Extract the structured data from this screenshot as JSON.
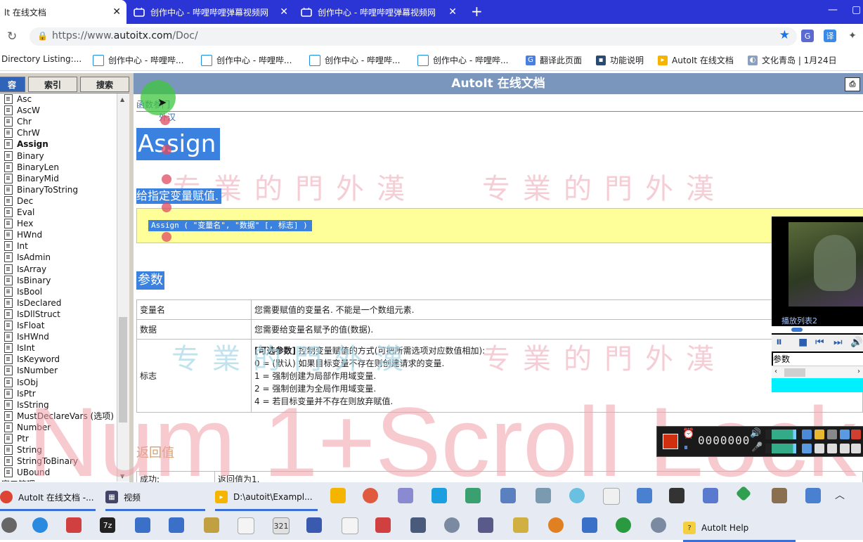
{
  "browser": {
    "tabs": [
      {
        "title": "lt 在线文档",
        "active": true
      },
      {
        "title": "创作中心 - 哔哩哔哩弹幕视频网",
        "active": false
      },
      {
        "title": "创作中心 - 哔哩哔哩弹幕视频网",
        "active": false
      }
    ],
    "new_tab": "+",
    "url_prefix": "https://www.",
    "url_host": "autoitx.com",
    "url_path": "/Doc/",
    "ext_translate": "译",
    "bookmarks": [
      "Directory Listing:...",
      "创作中心 - 哔哩哔...",
      "创作中心 - 哔哩哔...",
      "创作中心 - 哔哩哔...",
      "创作中心 - 哔哩哔...",
      "翻译此页面",
      "功能说明",
      "AutoIt 在线文档",
      "文化青岛 | 1月24日"
    ]
  },
  "help": {
    "left_tabs": [
      "容",
      "索引",
      "搜索"
    ],
    "tree_items": [
      "Asc",
      "AscW",
      "Chr",
      "ChrW",
      "Assign",
      "Binary",
      "BinaryLen",
      "BinaryMid",
      "BinaryToString",
      "Dec",
      "Eval",
      "Hex",
      "HWnd",
      "Int",
      "IsAdmin",
      "IsArray",
      "IsBinary",
      "IsBool",
      "IsDeclared",
      "IsDllStruct",
      "IsFloat",
      "IsHWnd",
      "IsInt",
      "IsKeyword",
      "IsNumber",
      "IsObj",
      "IsPtr",
      "IsString",
      "MustDeclareVars (选项)",
      "Number",
      "Ptr",
      "String",
      "StringToBinary",
      "UBound"
    ],
    "tree_bottom": "窗口管理",
    "header_title": "AutoIt 在线文档",
    "breadcrumb": "函数参门",
    "breadcrumb2": "外汉",
    "func_name": "Assign",
    "func_desc": "给指定变量赋值.",
    "syntax": "Assign ( \"变量名\", \"数据\" [, 标志] )",
    "params_heading": "参数",
    "params": [
      {
        "name": "变量名",
        "desc": "您需要赋值的变量名. 不能是一个数组元素."
      },
      {
        "name": "数据",
        "desc": "您需要给变量名赋予的值(数据)."
      }
    ],
    "flag_name": "标志",
    "flag_lines": [
      {
        "strong": "[可选参数]",
        "text": " 控制变量赋值的方式(可把所需选项对应数值相加):"
      },
      {
        "strong": "",
        "text": "0 = (默认) 如果目标变量不存在则创建请求的变量."
      },
      {
        "strong": "",
        "text": "1 = 强制创建为局部作用域变量."
      },
      {
        "strong": "",
        "text": "2 = 强制创建为全局作用域变量."
      },
      {
        "strong": "",
        "text": "4 = 若目标变量并不存在则放弃赋值."
      }
    ],
    "return_heading": "返回值",
    "return_rows": [
      {
        "k": "成功:",
        "v": "返回值为1."
      }
    ]
  },
  "watermark": {
    "seal_text": "专業的門外漢",
    "big_text": "Num 1+Scroll Lock"
  },
  "player": {
    "playlist_label": "播放列表2",
    "param_label": "参数"
  },
  "media_toolbar": {
    "counter": "0000000"
  },
  "taskbar": {
    "windows": [
      {
        "label": "AutoIt 在线文档 -...",
        "color": "#dd4433",
        "active": true
      },
      {
        "label": "视频",
        "color": "#444466",
        "active": true
      },
      {
        "label": "D:\\autoit\\Exampl...",
        "color": "#f4b400",
        "active": true
      }
    ],
    "autoit_help": "AutoIt Help"
  },
  "colors": {
    "tabbar": "#2b35d6",
    "help_header": "#7b96bc",
    "selection": "#3b82e0",
    "codebox": "#ffff99"
  }
}
